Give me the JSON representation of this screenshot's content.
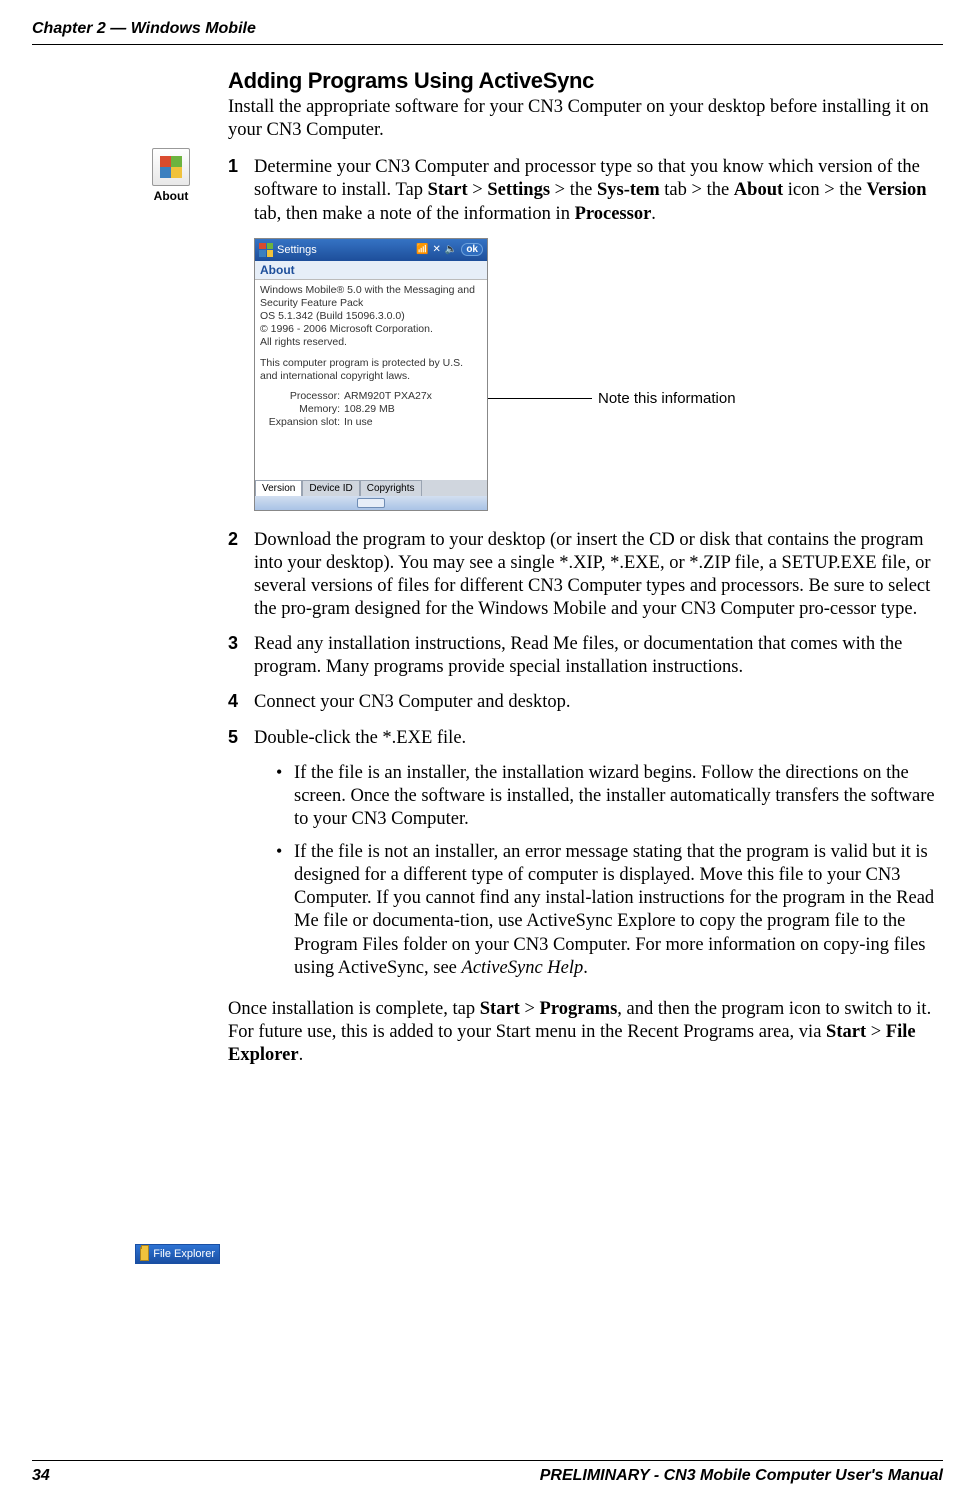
{
  "header": {
    "chapter": "Chapter 2 — Windows Mobile"
  },
  "section": {
    "title": "Adding Programs Using ActiveSync",
    "intro": "Install the appropriate software for your CN3 Computer on your desktop before installing it on your CN3 Computer."
  },
  "aboutIcon": {
    "label": "About"
  },
  "step1": {
    "num": "1",
    "pre": "Determine your CN3 Computer and processor type so that you know which version of the software to install. Tap ",
    "b1": "Start",
    "s1": " > ",
    "b2": "Settings",
    "s2": " > the ",
    "b3": "Sys-tem",
    "s3": " tab > the ",
    "b4": "About",
    "s4": " icon > the ",
    "b5": "Version",
    "s5": " tab, then make a note of the information in ",
    "b6": "Processor",
    "s6": "."
  },
  "screenshot": {
    "titlebar": "Settings",
    "ok": "ok",
    "subtitle": "About",
    "line1": "Windows Mobile® 5.0 with the Messaging and Security Feature Pack",
    "line2": "OS 5.1.342 (Build 15096.3.0.0)",
    "line3": "© 1996 - 2006 Microsoft Corporation.",
    "line4": "All rights reserved.",
    "line5": "This computer program is protected by U.S. and international copyright laws.",
    "proc_label": "Processor:",
    "proc_val": "ARM920T PXA27x",
    "mem_label": "Memory:",
    "mem_val": "108.29 MB",
    "exp_label": "Expansion slot:",
    "exp_val": "In use",
    "tab_version": "Version",
    "tab_deviceid": "Device ID",
    "tab_copyrights": "Copyrights"
  },
  "callout": {
    "text": "Note this information"
  },
  "step2": {
    "num": "2",
    "text": "Download the program to your desktop (or insert the CD or disk that contains the program into your desktop). You may see a single *.XIP, *.EXE, or *.ZIP file, a SETUP.EXE file, or several versions of files for different CN3 Computer types and processors. Be sure to select the pro-gram designed for the Windows Mobile and your CN3 Computer pro-cessor type."
  },
  "step3": {
    "num": "3",
    "text": "Read any installation instructions, Read Me files, or documentation that comes with the program. Many programs provide special installation instructions."
  },
  "step4": {
    "num": "4",
    "text": "Connect your CN3 Computer and desktop."
  },
  "step5": {
    "num": "5",
    "text": "Double-click the *.EXE file."
  },
  "bullet1": {
    "text": "If the file is an installer, the installation wizard begins. Follow the directions on the screen. Once the software is installed, the installer automatically transfers the software to your CN3 Computer."
  },
  "bullet2": {
    "text_pre": "If the file is not an installer, an error message stating that the program is valid but it is designed for a different type of computer is displayed. Move this file to your CN3 Computer. If you cannot find any instal-lation instructions for the program in the Read Me file or documenta-tion, use ActiveSync Explore to copy the program file to the Program Files folder on your CN3 Computer. For more information on copy-ing files using ActiveSync, see ",
    "italic": "ActiveSync Help",
    "text_post": "."
  },
  "fileExplorer": {
    "label": "File Explorer"
  },
  "final": {
    "pre": "Once installation is complete, tap ",
    "b1": "Start",
    "s1": " > ",
    "b2": "Programs",
    "mid": ", and then the program icon to switch to it. For future use, this is added to your Start menu in the Recent Programs area, via ",
    "b3": "Start",
    "s2": " > ",
    "b4": "File Explorer",
    "s3": "."
  },
  "footer": {
    "page": "34",
    "right": "PRELIMINARY - CN3 Mobile Computer User's Manual"
  }
}
